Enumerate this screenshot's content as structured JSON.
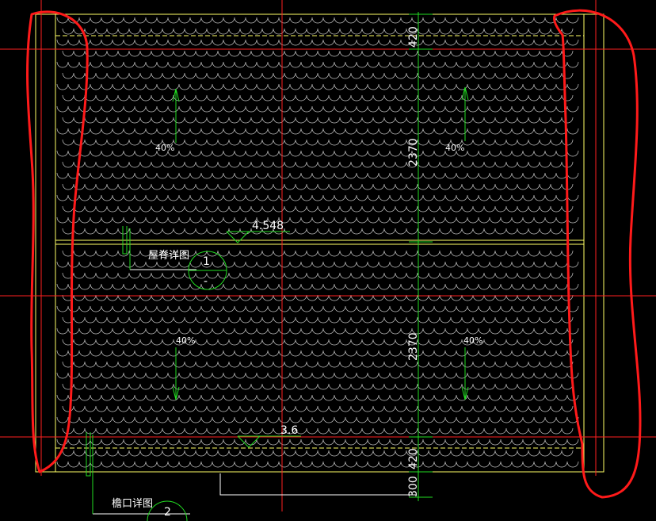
{
  "drawing": {
    "dims": {
      "top_eave": "420",
      "upper_span": "2370",
      "lower_span": "2370",
      "bottom_eave": "420",
      "overhang": "300"
    },
    "slopes": {
      "upper_left": "40%",
      "upper_right": "40%",
      "lower_left": "40%",
      "lower_right": "40%"
    },
    "elevations": {
      "ridge": "4.548",
      "eave": "3.6"
    },
    "details": {
      "ridge_label": "屋脊详图",
      "ridge_number": "1",
      "ridge_sheet": "-",
      "eave_label": "檐口详图",
      "eave_number": "2"
    },
    "colors": {
      "background": "#000000",
      "tile": "#c8c8c8",
      "outline": "#ffff66",
      "axis": "#ff2020",
      "dimension": "#22dd22",
      "annotation": "#ffffff",
      "markup": "#ff1a1a"
    }
  }
}
